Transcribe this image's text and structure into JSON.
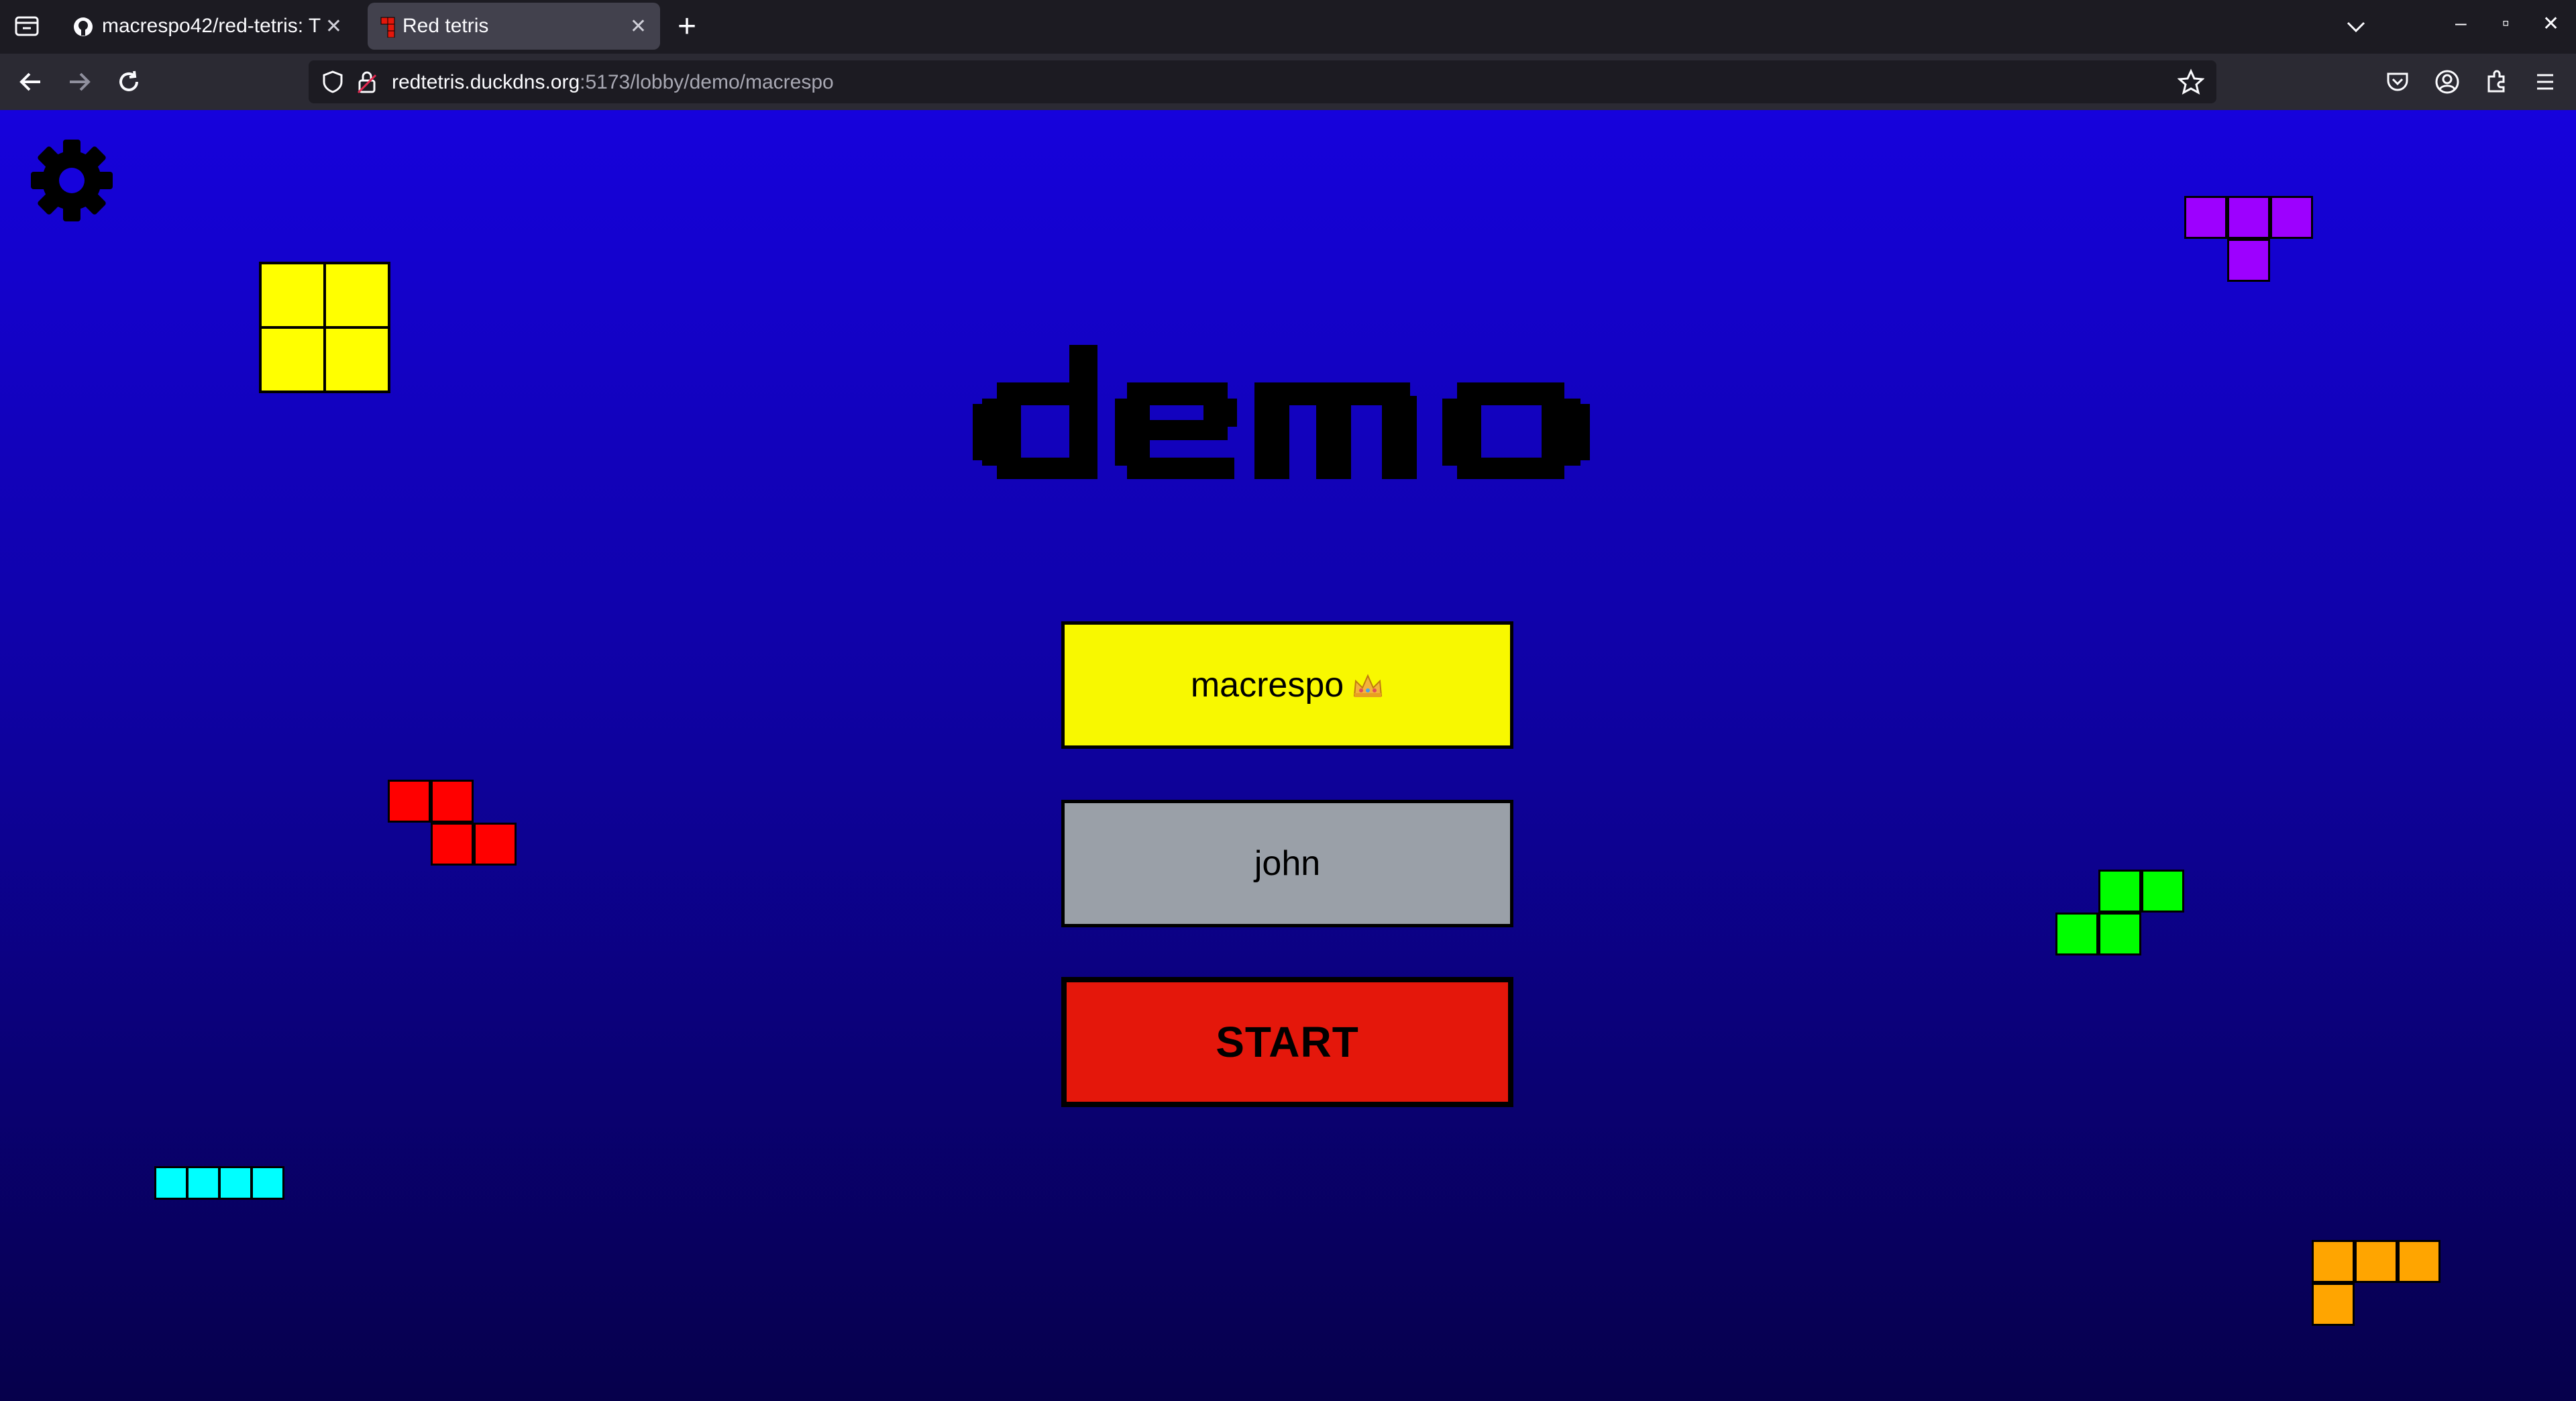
{
  "browser": {
    "tabs": [
      {
        "label": "macrespo42/red-tetris: T",
        "active": false
      },
      {
        "label": "Red tetris",
        "active": true
      }
    ],
    "new_tab": "+",
    "url_host": "redtetris.duckdns.org",
    "url_path": ":5173/lobby/demo/macrespo"
  },
  "page": {
    "room_title": "demo",
    "players": [
      {
        "name": "macrespo",
        "is_host": true,
        "color": "#f8f800"
      },
      {
        "name": "john",
        "is_host": false,
        "color": "#9aa0a8"
      }
    ],
    "start_label": "START",
    "decor_pieces": [
      {
        "name": "O-piece",
        "color": "#ffff00"
      },
      {
        "name": "T-piece",
        "color": "#9d00ff"
      },
      {
        "name": "Z-piece",
        "color": "#ff0000"
      },
      {
        "name": "S-piece",
        "color": "#00ff00"
      },
      {
        "name": "I-piece",
        "color": "#00ffff"
      },
      {
        "name": "L-piece",
        "color": "#ffa500"
      }
    ]
  },
  "icons": {
    "settings": "gear-icon",
    "host_badge": "crown-icon"
  },
  "colors": {
    "background_top": "#1602dc",
    "background_bottom": "#06004b",
    "start_button": "#e4170b"
  }
}
